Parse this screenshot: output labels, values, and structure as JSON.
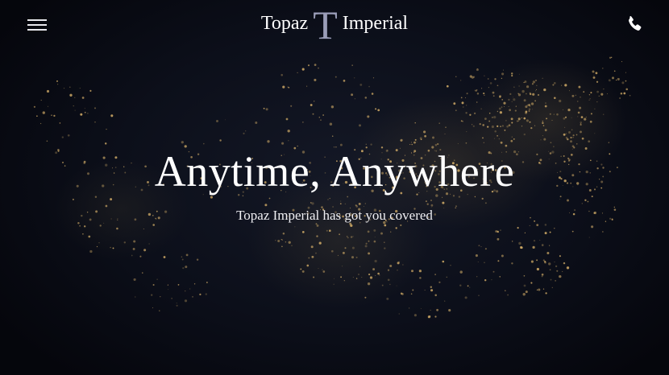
{
  "header": {
    "menu_icon": "hamburger-menu-icon",
    "logo": {
      "left_word": "Topaz",
      "mark": "T",
      "right_word": "Imperial",
      "mark_color": "#9a9db8"
    },
    "phone_icon": "phone-icon"
  },
  "hero": {
    "background": "night-satellite-map-usa",
    "light_color": "#d9b26a",
    "headline": "Anytime, Anywhere",
    "subheadline": "Topaz Imperial has got you covered"
  }
}
